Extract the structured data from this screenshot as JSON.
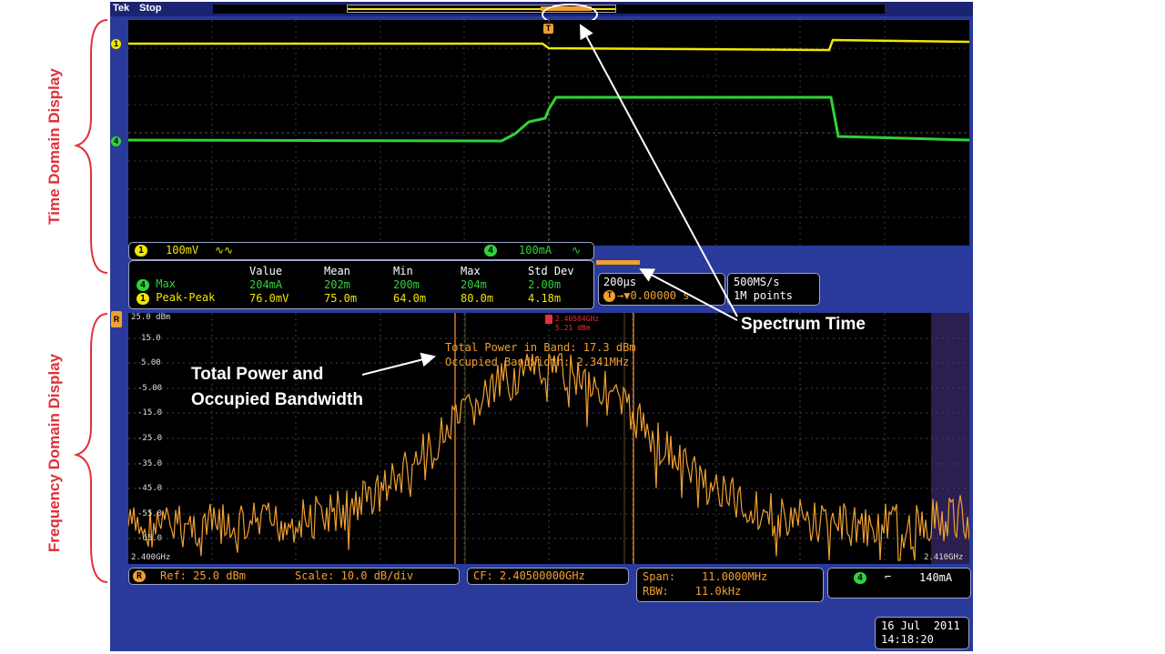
{
  "annotations": {
    "time_domain": "Time Domain Display",
    "frequency_domain": "Frequency Domain Display",
    "spectrum_time": "Spectrum Time",
    "total_power_line1": "Total Power and",
    "total_power_line2": "Occupied Bandwidth"
  },
  "top_bar": {
    "brand": "Tek",
    "status": "Stop"
  },
  "channels": {
    "ch1_marker": "1",
    "ch4_marker": "4",
    "trigger_marker": "T"
  },
  "scale_box": {
    "ch1_num": "1",
    "ch1_scale": "100mV",
    "ch1_bw": "∿∿",
    "ch4_num": "4",
    "ch4_scale": "100mA",
    "ch4_bw": "∿"
  },
  "measurements": {
    "headers": [
      "Value",
      "Mean",
      "Min",
      "Max",
      "Std Dev"
    ],
    "rows": [
      {
        "ch": "4",
        "name": "Max",
        "values": [
          "204mA",
          "202m",
          "200m",
          "204m",
          "2.00m"
        ]
      },
      {
        "ch": "1",
        "name": "Peak-Peak",
        "values": [
          "76.0mV",
          "75.0m",
          "64.0m",
          "80.0m",
          "4.18m"
        ]
      }
    ]
  },
  "timebase": {
    "scale": "200µs",
    "trig_badge": "T",
    "position": "→▼0.00000 s"
  },
  "acquisition": {
    "rate": "500MS/s",
    "points": "1M points"
  },
  "rf": {
    "badge": "R",
    "marker_freq": "2.40504GHz",
    "marker_level": "5.21 dBm",
    "measurement_line1": "Total Power in Band: 17.3 dBm",
    "measurement_line2": "Occupied Bandwidth: 2.341MHz",
    "y_ticks": [
      "25.0 dBm",
      "15.0",
      "5.00",
      "-5.00",
      "-15.0",
      "-25.0",
      "-35.0",
      "-45.0",
      "-55.0",
      "-65.0"
    ],
    "x_start": "2.400GHz",
    "x_stop": "2.410GHz",
    "ref": "Ref: 25.0 dBm",
    "scale": "Scale: 10.0 dB/div",
    "cf": "CF: 2.40500000GHz",
    "span": "Span:    11.0000MHz",
    "rbw": "RBW:    11.0kHz"
  },
  "trigger": {
    "ch": "4",
    "slope": "⌐",
    "level": "140mA"
  },
  "datetime": {
    "date": "16 Jul  2011",
    "time": "14:18:20"
  },
  "colors": {
    "ch1": "#f2e600",
    "ch4": "#2fd23a",
    "rf": "#f0a030",
    "annotation": "#e0303a",
    "bezel": "#2a3a9a"
  }
}
